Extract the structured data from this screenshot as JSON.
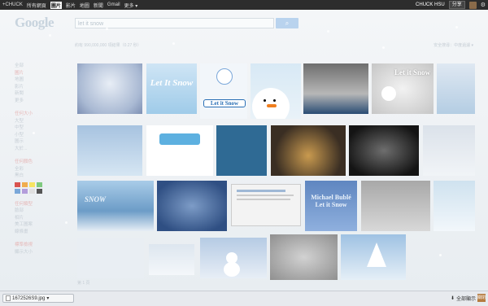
{
  "topbar": {
    "nav": [
      "+CHUCK",
      "所有網頁",
      "圖片",
      "影片",
      "地圖",
      "新聞",
      "Gmail",
      "更多"
    ],
    "active_index": 2,
    "more_arrow": "▾",
    "user": "CHUCK HSU",
    "share_label": "分享",
    "gear_icon": "gear-icon"
  },
  "header": {
    "logo": "Google",
    "search_value": "let it snow",
    "search_icon": "search-icon",
    "stats": "約有 990,000,000 項結果（0.27 秒）",
    "safe_search": "安全搜尋：中度過濾 ▾"
  },
  "sidebar": {
    "items": [
      "全部",
      "圖片",
      "地圖",
      "影片",
      "新聞",
      "更多"
    ],
    "active_index": 1,
    "group1": [
      "任何大小",
      "大型",
      "中型",
      "小型",
      "圖示",
      "大於..."
    ],
    "group2": [
      "任何顏色",
      "全彩",
      "黑白"
    ],
    "group3": [
      "任何類型",
      "臉部",
      "相片",
      "美工圖案",
      "線條畫"
    ],
    "group4": [
      "標準檢視",
      "顯示大小"
    ],
    "colors": [
      "#d9534f",
      "#f0ad4e",
      "#f7e463",
      "#7fc97f",
      "#7aa7d9",
      "#b39ddb",
      "#e0e0e0",
      "#555555"
    ]
  },
  "results": [
    {
      "alt": "snowy tree"
    },
    {
      "alt": "Let it Snow blue",
      "text": "Let It Snow"
    },
    {
      "alt": "cartoon Let it Snow",
      "text": "Let it Snow"
    },
    {
      "alt": "snowman face"
    },
    {
      "alt": "snowy houses"
    },
    {
      "alt": "Let it Snow snowman",
      "text": "Let it Snow"
    },
    {
      "alt": "blue snowflake"
    },
    {
      "alt": "snowman globe"
    },
    {
      "alt": "teal snowflakes"
    },
    {
      "alt": "village night"
    },
    {
      "alt": "dark snowflakes"
    },
    {
      "alt": "grey snow"
    },
    {
      "alt": "blue snow",
      "text": "SNOW"
    },
    {
      "alt": "deep blue flakes"
    },
    {
      "alt": "screenshot"
    },
    {
      "alt": "Michael Buble",
      "text": "Michael Bublé Let it Snow"
    },
    {
      "alt": "foggy"
    },
    {
      "alt": "light blue"
    },
    {
      "alt": "pale"
    },
    {
      "alt": "pale 2"
    },
    {
      "alt": "snowman"
    },
    {
      "alt": "fog 2"
    },
    {
      "alt": "tree"
    }
  ],
  "page_num": "第 1 頁",
  "download": {
    "filename": "1672526S9.jpg",
    "arrow": "▾",
    "show_all": "全部顯示",
    "show_all_icon": "download-icon",
    "close_label": "關閉"
  }
}
